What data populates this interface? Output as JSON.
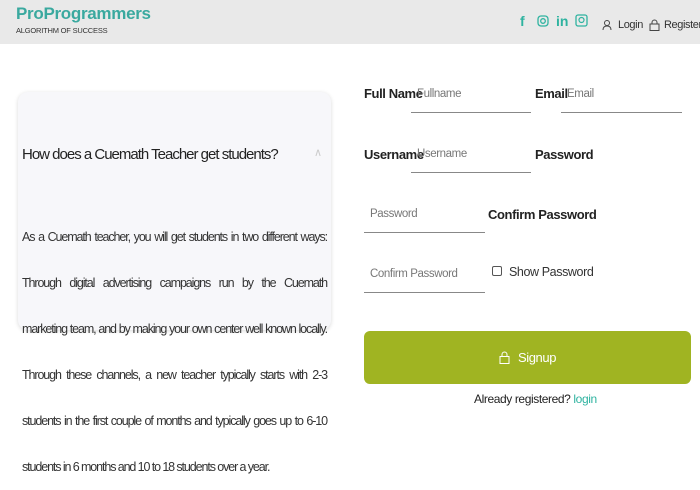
{
  "header": {
    "brand": "ProProgrammers",
    "tagline": "ALGORITHM OF SUCCESS",
    "social": [
      "facebook-icon",
      "instagram-icon",
      "linkedin-icon",
      "email-icon"
    ],
    "login": "Login",
    "register": "Register",
    "brand_color": "#3aa99f"
  },
  "faq": {
    "question": "How does a Cuemath Teacher get students?",
    "answer": "As a Cuemath teacher, you will get students in two different ways: Through digital advertising campaigns run by the Cuemath marketing team, and by making your own center well known locally. Through these channels, a new teacher typically starts with 2-3 students in the first couple of months and typically goes up to 6-10 students in 6 months and 10 to 18 students over a year."
  },
  "form": {
    "full_name_label": "Full Name",
    "full_name_placeholder": "Fullname",
    "email_label": "Email",
    "email_placeholder": "Email",
    "username_label": "Username",
    "username_placeholder": "Username",
    "password_label": "Password",
    "password_placeholder": "Password",
    "confirm_label": "Confirm Password",
    "confirm_placeholder": "Confirm Password",
    "show_password": "Show Password",
    "show_password_checked": false,
    "signup": "Signup",
    "signup_color": "#a0b422",
    "already": "Already registered?",
    "login_link": "login"
  }
}
